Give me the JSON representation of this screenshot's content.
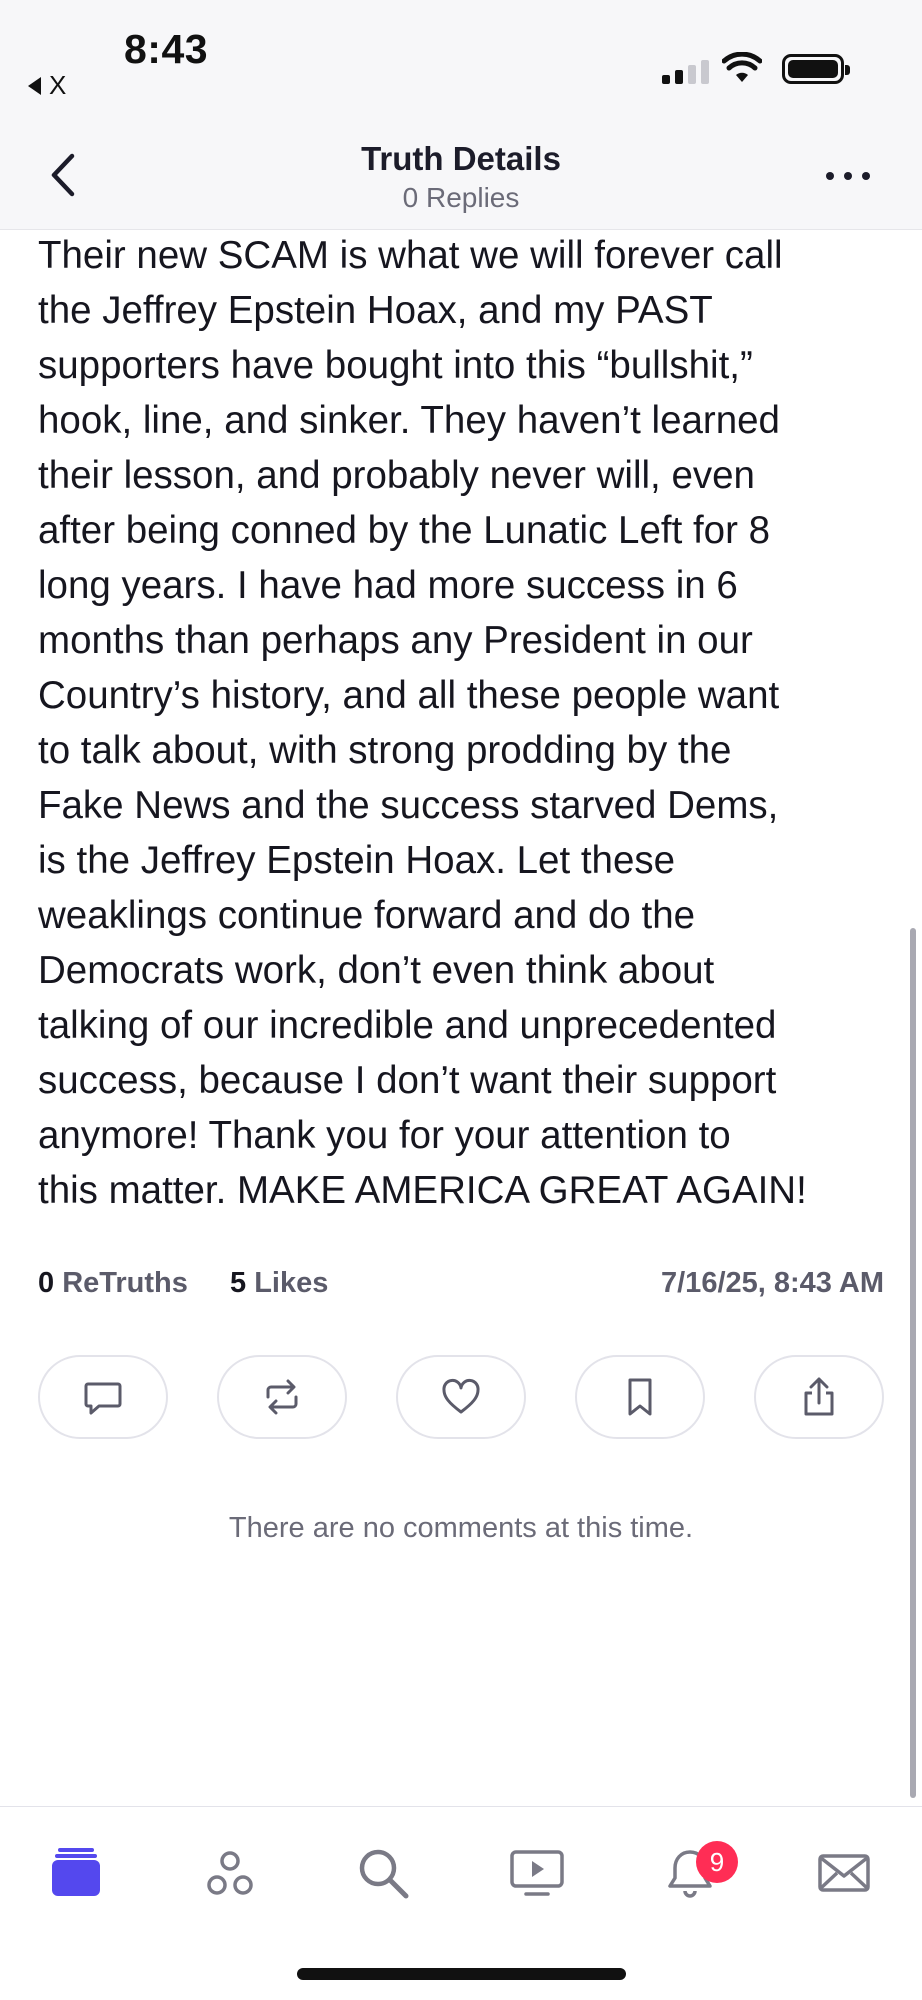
{
  "status_bar": {
    "time": "8:43",
    "back_app_label": "X"
  },
  "header": {
    "title": "Truth Details",
    "subtitle": "0 Replies"
  },
  "post": {
    "text": "Their new SCAM is what we will forever call\nthe Jeffrey Epstein Hoax, and my PAST\nsupporters have bought into this “bullshit,”\nhook, line, and sinker. They haven’t learned\ntheir lesson, and probably never will, even\nafter being conned by the Lunatic Left for 8\nlong years. I have had more success in 6\nmonths than perhaps any President in our\nCountry’s history, and all these people want\nto talk about, with strong prodding by the\nFake News and the success starved Dems,\nis the Jeffrey Epstein Hoax. Let these\nweaklings continue forward and do the\nDemocrats work, don’t even think about\ntalking of our incredible and unprecedented\nsuccess, because I don’t want their support\nanymore! Thank you for your attention to\nthis matter. MAKE AMERICA GREAT AGAIN!",
    "retruths_count": "0",
    "retruths_label": "ReTruths",
    "likes_count": "5",
    "likes_label": "Likes",
    "timestamp": "7/16/25, 8:43 AM"
  },
  "actions": {
    "icons": [
      "comment-icon",
      "retruth-icon",
      "like-icon",
      "bookmark-icon",
      "share-icon"
    ]
  },
  "comments": {
    "empty_message": "There are no comments at this time."
  },
  "bottom_nav": {
    "icons": [
      "home-icon",
      "groups-icon",
      "search-icon",
      "video-icon",
      "notifications-icon",
      "messages-icon"
    ],
    "notification_count": "9",
    "active_color": "#5448ee"
  },
  "colors": {
    "accent": "#5448ee",
    "badge": "#ff2d55",
    "text": "#16161f",
    "muted": "#6b6b78"
  }
}
